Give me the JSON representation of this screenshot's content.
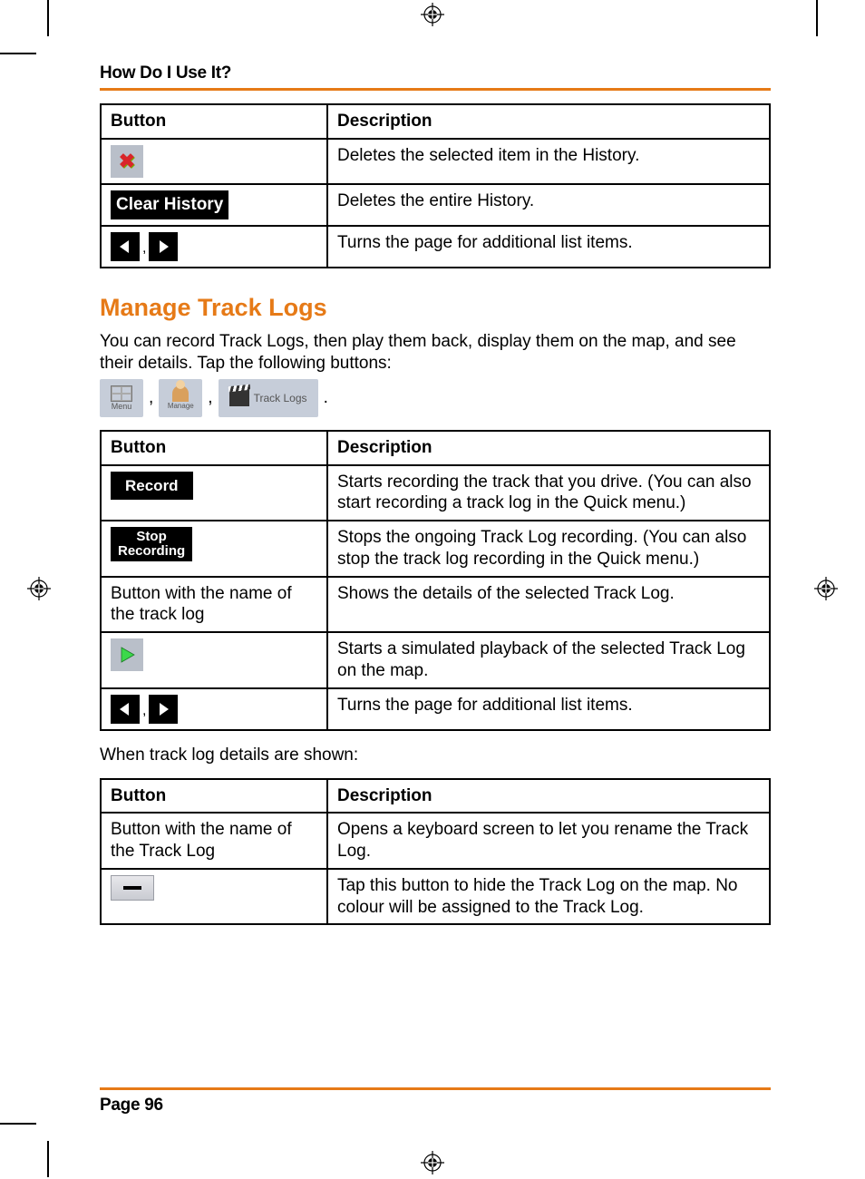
{
  "header": {
    "running_head": "How Do I Use It?"
  },
  "table1": {
    "headers": {
      "button": "Button",
      "description": "Description"
    },
    "rows": [
      {
        "btn_label": "✖",
        "desc": "Deletes the selected item in the History."
      },
      {
        "btn_label": "Clear History",
        "desc": "Deletes the entire History."
      },
      {
        "btn_label_nav": ",",
        "desc": "Turns the page for additional list items."
      }
    ]
  },
  "section": {
    "title": "Manage Track Logs",
    "intro": "You can record Track Logs, then play them back, display them on the map, and see their details. Tap the following buttons:",
    "crumbs": {
      "menu_label": "Menu",
      "manage_label": "Manage",
      "tracklogs_label": "Track Logs"
    }
  },
  "table2": {
    "headers": {
      "button": "Button",
      "description": "Description"
    },
    "rows": [
      {
        "btn_label": "Record",
        "desc": "Starts recording the track that you drive. (You can also start recording a track log in the Quick menu.)"
      },
      {
        "btn_label": "Stop\nRecording",
        "desc": "Stops the ongoing Track Log recording. (You can also stop the track log recording in the Quick menu.)"
      },
      {
        "btn_text": "Button with the name of the track log",
        "desc": "Shows the details of the selected Track Log."
      },
      {
        "btn_play": true,
        "desc": "Starts a simulated playback of the selected Track Log on the map."
      },
      {
        "btn_nav": true,
        "desc": "Turns the page for additional list items."
      }
    ]
  },
  "intermission": "When track log details are shown:",
  "table3": {
    "headers": {
      "button": "Button",
      "description": "Description"
    },
    "rows": [
      {
        "btn_text": "Button with the name of the Track Log",
        "desc": "Opens a keyboard screen to let you rename the Track Log."
      },
      {
        "btn_hide": true,
        "desc": "Tap this button to hide the Track Log on the map. No colour will be assigned to the Track Log."
      }
    ]
  },
  "footer": {
    "page_label": "Page 96"
  }
}
